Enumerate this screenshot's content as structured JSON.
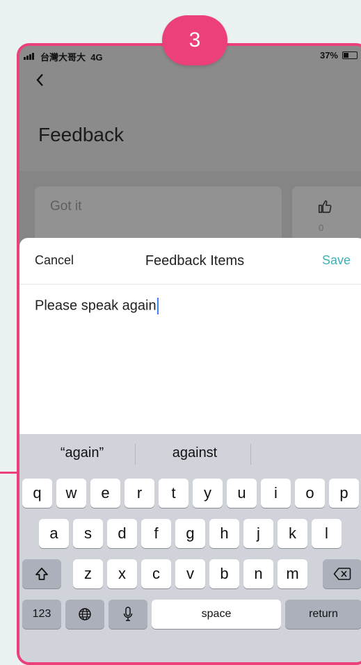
{
  "step_badge": "3",
  "status_bar": {
    "carrier": "台灣大哥大",
    "network": "4G",
    "battery": "37%"
  },
  "page": {
    "title": "Feedback"
  },
  "feedback_card": {
    "text": "Got it",
    "like_count": "0"
  },
  "sheet": {
    "cancel": "Cancel",
    "title": "Feedback Items",
    "save": "Save",
    "input_value": "Please speak again"
  },
  "keyboard": {
    "suggestions": [
      "“again”",
      "against"
    ],
    "row1": [
      "q",
      "w",
      "e",
      "r",
      "t",
      "y",
      "u",
      "i",
      "o",
      "p"
    ],
    "row2": [
      "a",
      "s",
      "d",
      "f",
      "g",
      "h",
      "j",
      "k",
      "l"
    ],
    "row3": [
      "z",
      "x",
      "c",
      "v",
      "b",
      "n",
      "m"
    ],
    "numbers_key": "123",
    "space_key": "space",
    "return_key": "return"
  },
  "colors": {
    "accent": "#ec407a",
    "save": "#3fb0b7",
    "caret": "#3b82f6"
  }
}
